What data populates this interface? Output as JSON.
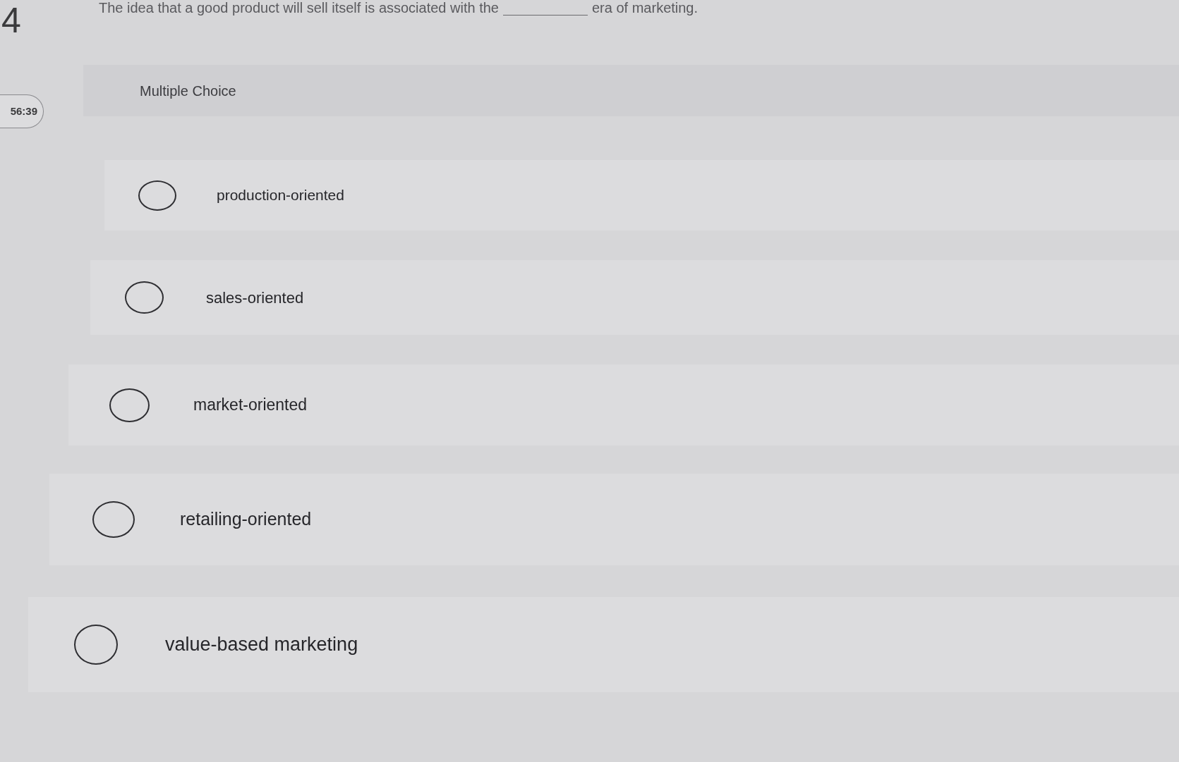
{
  "question": {
    "number": "4",
    "text_before": "The idea that a good product will sell itself is associated with the",
    "text_after": "era of marketing."
  },
  "timer": "56:39",
  "question_type": "Multiple Choice",
  "options": [
    {
      "label": "production-oriented",
      "selected": false
    },
    {
      "label": "sales-oriented",
      "selected": false
    },
    {
      "label": "market-oriented",
      "selected": false
    },
    {
      "label": "retailing-oriented",
      "selected": false
    },
    {
      "label": "value-based marketing",
      "selected": false
    }
  ]
}
